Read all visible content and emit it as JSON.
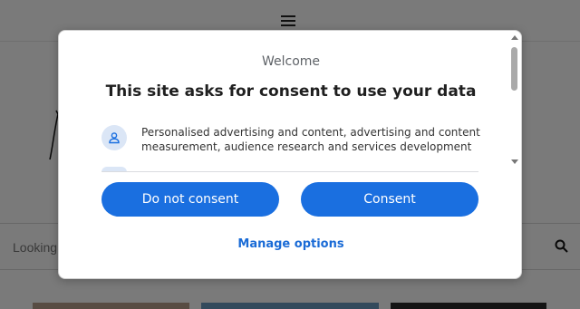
{
  "background": {
    "search": {
      "placeholder": "Looking"
    }
  },
  "consent_dialog": {
    "welcome": "Welcome",
    "headline": "This site asks for consent to use your data",
    "purposes": [
      {
        "icon": "person-icon",
        "text": "Personalised advertising and content, advertising and content measurement, audience research and services development"
      }
    ],
    "buttons": {
      "decline": "Do not consent",
      "consent": "Consent"
    },
    "manage_link": "Manage options"
  },
  "colors": {
    "primary_button": "#1a6fe0",
    "link": "#1a6bd6",
    "overlay": "rgba(0,0,0,0.52)",
    "icon_bg": "#dbe6f6"
  }
}
